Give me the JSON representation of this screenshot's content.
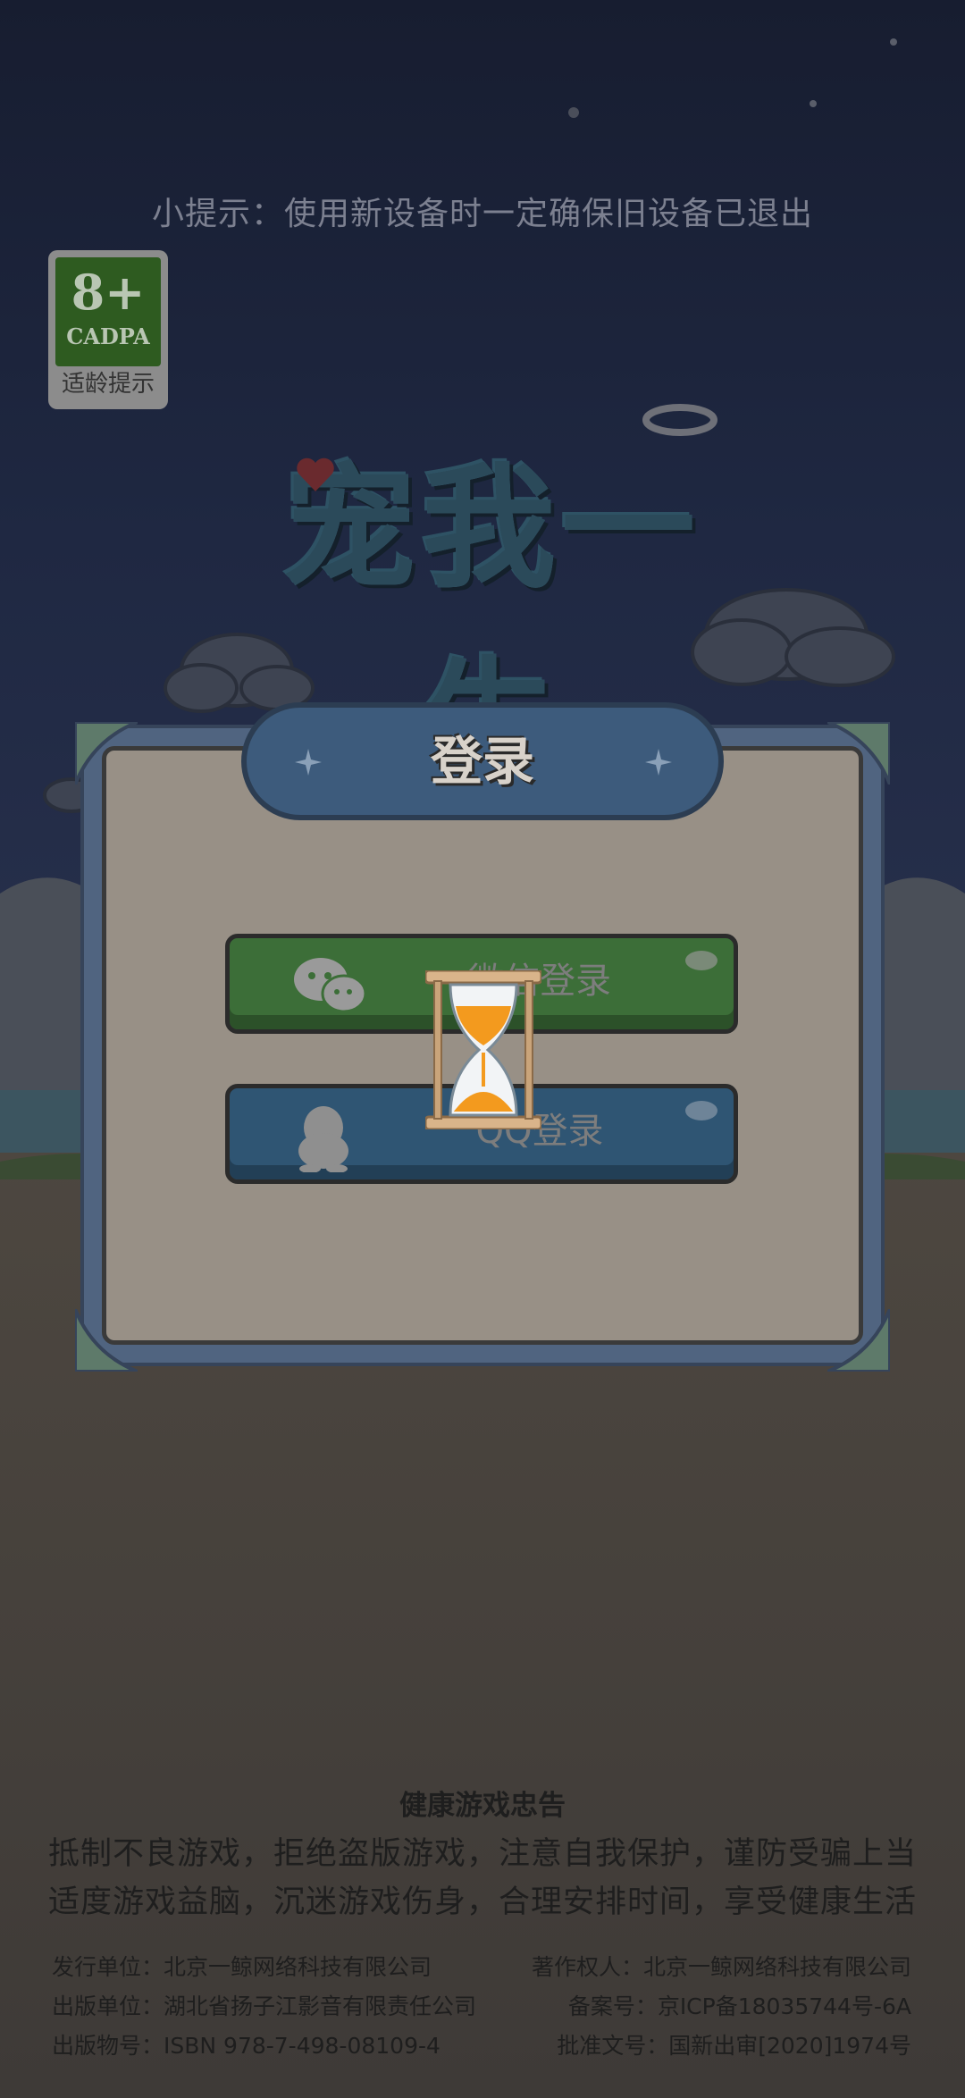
{
  "tip": "小提示：使用新设备时一定确保旧设备已退出",
  "age_rating": {
    "number": "8+",
    "org": "CADPA",
    "label": "适龄提示"
  },
  "game_title": "宠我一生",
  "login_panel": {
    "title": "登录",
    "wechat_label": "微信登录",
    "qq_label": "QQ登录"
  },
  "health_notice": {
    "title": "健康游戏忠告",
    "line1": "抵制不良游戏，拒绝盗版游戏，注意自我保护，谨防受骗上当",
    "line2": "适度游戏益脑，沉迷游戏伤身，合理安排时间，享受健康生活"
  },
  "publisher_info": {
    "left": [
      "发行单位：北京一鲸网络科技有限公司",
      "出版单位：湖北省扬子江影音有限责任公司",
      "出版物号：ISBN 978-7-498-08109-4"
    ],
    "right": [
      "著作权人：北京一鲸网络科技有限公司",
      "备案号：京ICP备18035744号-6A",
      "批准文号：国新出审[2020]1974号"
    ]
  },
  "colors": {
    "sky": "#1b2238",
    "ground": "#4a4540",
    "panel_frame": "#506480",
    "panel_body": "#989086",
    "wechat_button": "#3c6e38",
    "qq_button": "#2f5573",
    "hourglass_sand": "#f39a1e"
  },
  "icons": [
    "wechat-icon",
    "qq-icon",
    "hourglass-icon"
  ]
}
